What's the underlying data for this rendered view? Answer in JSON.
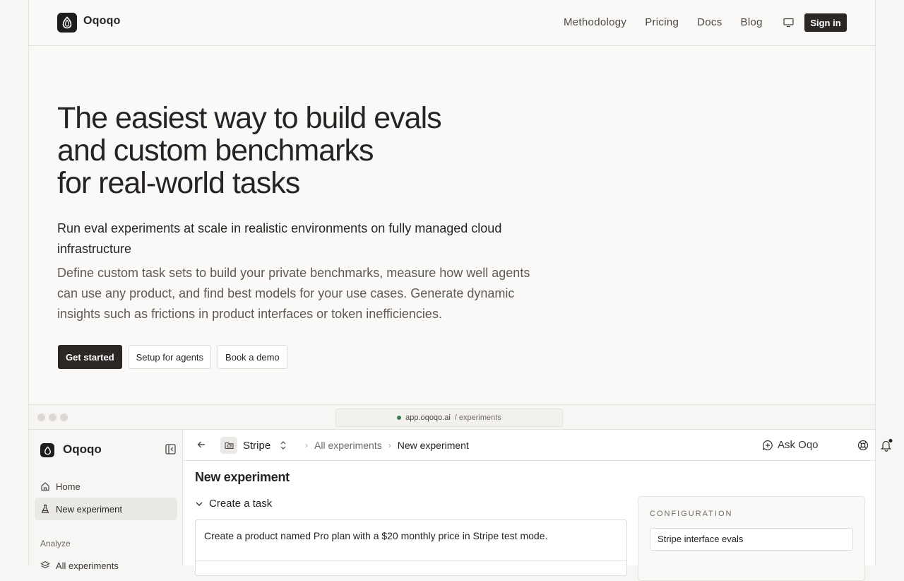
{
  "brand": "Oqoqo",
  "nav": {
    "links": [
      "Methodology",
      "Pricing",
      "Docs",
      "Blog"
    ],
    "signin": "Sign in"
  },
  "hero": {
    "title_lines": [
      "The easiest way to build evals",
      "and custom benchmarks",
      "for real-world tasks"
    ],
    "lead": "Run eval experiments at scale in realistic environments on fully managed cloud infrastructure",
    "sub": "Define custom task sets to build your private benchmarks, measure how well agents can use any product, and find best models for your use cases. Generate dynamic insights such as frictions in product interfaces or token inefficiencies.",
    "buttons": {
      "get_started": "Get started",
      "setup_agents": "Setup for agents",
      "book_demo": "Book a demo"
    }
  },
  "preview": {
    "url_host": "app.oqoqo.ai",
    "url_path": "/ experiments",
    "sidebar": {
      "brand": "Oqoqo",
      "items": [
        {
          "label": "Home",
          "icon": "home-icon"
        },
        {
          "label": "New experiment",
          "icon": "flask-icon"
        }
      ],
      "section": "Analyze",
      "section_items": [
        {
          "label": "All experiments",
          "icon": "layers-icon"
        }
      ]
    },
    "crumbbar": {
      "project": "Stripe",
      "crumbs": [
        "All experiments",
        "New experiment"
      ],
      "ask": "Ask Oqo"
    },
    "page_title": "New experiment",
    "section_toggle": "Create a task",
    "task_text": "Create a product named Pro plan with a $20 monthly price in Stripe test mode.",
    "config": {
      "label": "CONFIGURATION",
      "name_value": "Stripe interface evals"
    }
  }
}
